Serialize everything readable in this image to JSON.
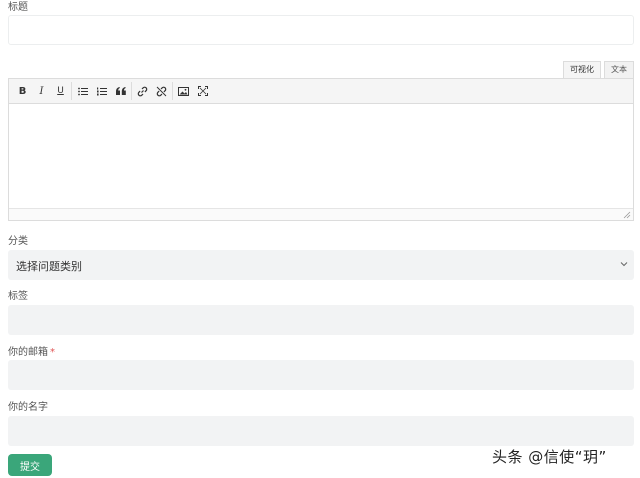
{
  "form": {
    "title_label": "标题",
    "mode_tabs": [
      "可视化",
      "文本"
    ],
    "category_label": "分类",
    "category_selected": "选择问题类别",
    "tags_label": "标签",
    "email_label": "你的邮箱",
    "email_required_mark": "*",
    "name_label": "你的名字",
    "submit_label": "提交"
  },
  "toolbar": {
    "bold": "B",
    "italic": "I",
    "underline": "U",
    "icons": [
      "bold-icon",
      "italic-icon",
      "underline-icon",
      "bullet-list-icon",
      "numbered-list-icon",
      "quote-icon",
      "link-icon",
      "unlink-icon",
      "image-icon",
      "fullscreen-icon"
    ]
  },
  "watermark": "头条 @信使“玥”",
  "colors": {
    "accent": "#3aa67a",
    "field_bg": "#f2f3f4",
    "toolbar_bg": "#f5f5f5"
  }
}
